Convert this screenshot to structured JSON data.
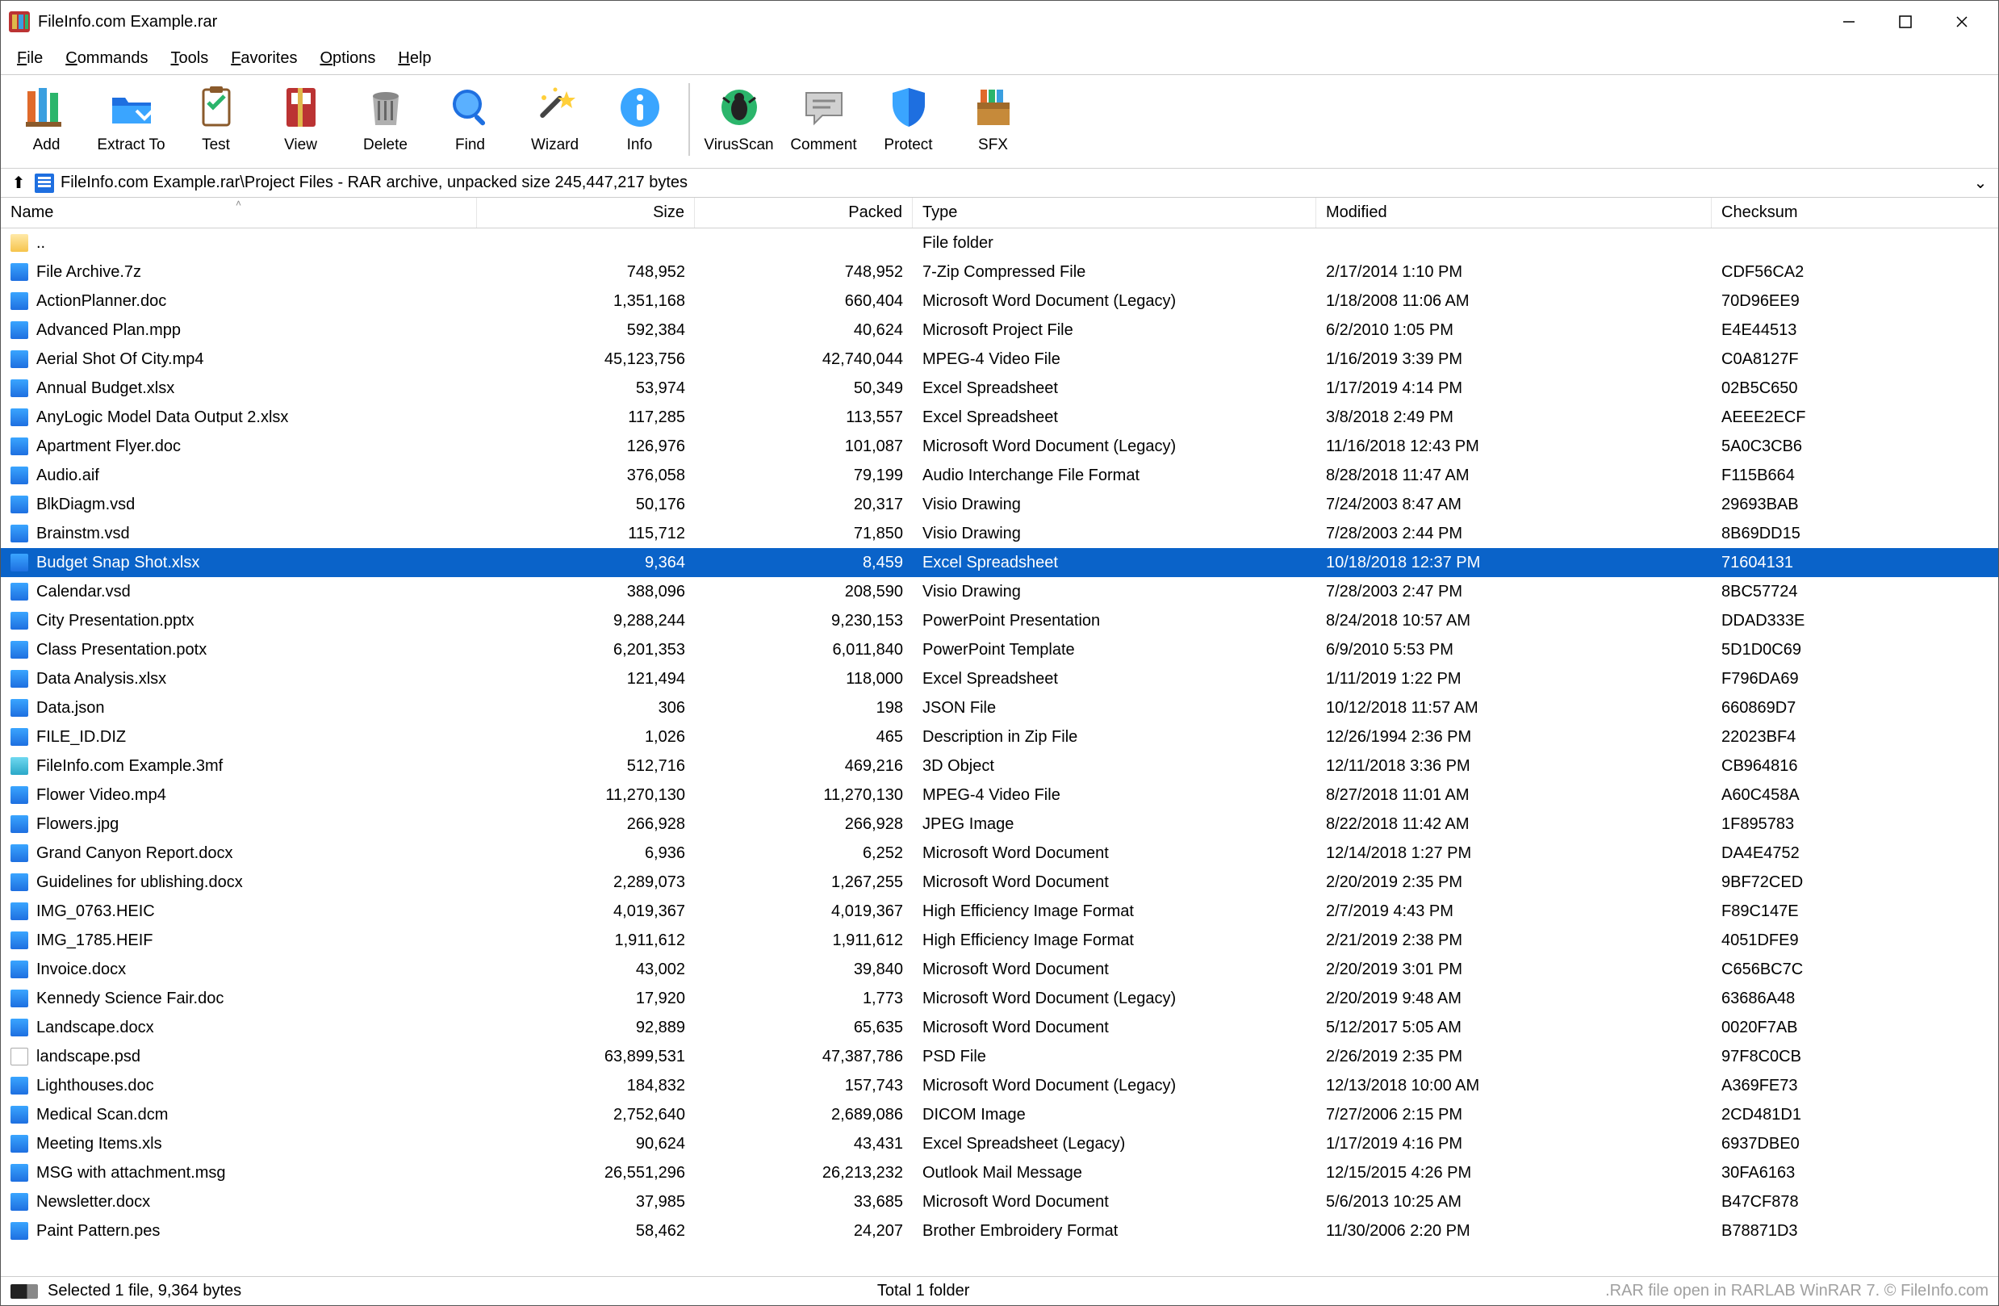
{
  "window": {
    "title": "FileInfo.com Example.rar"
  },
  "menu": {
    "items": [
      "File",
      "Commands",
      "Tools",
      "Favorites",
      "Options",
      "Help"
    ]
  },
  "toolbar": {
    "groups": [
      [
        {
          "name": "add",
          "label": "Add",
          "svg": "books"
        },
        {
          "name": "extract",
          "label": "Extract To",
          "svg": "folder"
        },
        {
          "name": "test",
          "label": "Test",
          "svg": "clipboard"
        },
        {
          "name": "view",
          "label": "View",
          "svg": "book"
        },
        {
          "name": "delete",
          "label": "Delete",
          "svg": "trash"
        },
        {
          "name": "find",
          "label": "Find",
          "svg": "lens"
        },
        {
          "name": "wizard",
          "label": "Wizard",
          "svg": "wand"
        },
        {
          "name": "info",
          "label": "Info",
          "svg": "info"
        }
      ],
      [
        {
          "name": "virusscan",
          "label": "VirusScan",
          "svg": "bug"
        },
        {
          "name": "comment",
          "label": "Comment",
          "svg": "comment"
        },
        {
          "name": "protect",
          "label": "Protect",
          "svg": "shield"
        },
        {
          "name": "sfx",
          "label": "SFX",
          "svg": "box"
        }
      ]
    ]
  },
  "address": {
    "path": "FileInfo.com Example.rar\\Project Files - RAR archive, unpacked size 245,447,217 bytes"
  },
  "columns": {
    "name": "Name",
    "size": "Size",
    "packed": "Packed",
    "type": "Type",
    "modified": "Modified",
    "checksum": "Checksum",
    "sort": "name"
  },
  "rows": [
    {
      "icon": "folder",
      "name": "..",
      "size": "",
      "packed": "",
      "type": "File folder",
      "mod": "",
      "chk": ""
    },
    {
      "icon": "blue",
      "name": "File Archive.7z",
      "size": "748,952",
      "packed": "748,952",
      "type": "7-Zip Compressed File",
      "mod": "2/17/2014 1:10 PM",
      "chk": "CDF56CA2"
    },
    {
      "icon": "blue",
      "name": "ActionPlanner.doc",
      "size": "1,351,168",
      "packed": "660,404",
      "type": "Microsoft Word Document (Legacy)",
      "mod": "1/18/2008 11:06 AM",
      "chk": "70D96EE9"
    },
    {
      "icon": "blue",
      "name": "Advanced Plan.mpp",
      "size": "592,384",
      "packed": "40,624",
      "type": "Microsoft Project File",
      "mod": "6/2/2010 1:05 PM",
      "chk": "E4E44513"
    },
    {
      "icon": "blue",
      "name": "Aerial Shot Of City.mp4",
      "size": "45,123,756",
      "packed": "42,740,044",
      "type": "MPEG-4 Video File",
      "mod": "1/16/2019 3:39 PM",
      "chk": "C0A8127F"
    },
    {
      "icon": "blue",
      "name": "Annual Budget.xlsx",
      "size": "53,974",
      "packed": "50,349",
      "type": "Excel Spreadsheet",
      "mod": "1/17/2019 4:14 PM",
      "chk": "02B5C650"
    },
    {
      "icon": "blue",
      "name": "AnyLogic Model Data Output 2.xlsx",
      "size": "117,285",
      "packed": "113,557",
      "type": "Excel Spreadsheet",
      "mod": "3/8/2018 2:49 PM",
      "chk": "AEEE2ECF"
    },
    {
      "icon": "blue",
      "name": "Apartment Flyer.doc",
      "size": "126,976",
      "packed": "101,087",
      "type": "Microsoft Word Document (Legacy)",
      "mod": "11/16/2018 12:43 PM",
      "chk": "5A0C3CB6"
    },
    {
      "icon": "blue",
      "name": "Audio.aif",
      "size": "376,058",
      "packed": "79,199",
      "type": "Audio Interchange File Format",
      "mod": "8/28/2018 11:47 AM",
      "chk": "F115B664"
    },
    {
      "icon": "blue",
      "name": "BlkDiagm.vsd",
      "size": "50,176",
      "packed": "20,317",
      "type": "Visio Drawing",
      "mod": "7/24/2003 8:47 AM",
      "chk": "29693BAB"
    },
    {
      "icon": "blue",
      "name": "Brainstm.vsd",
      "size": "115,712",
      "packed": "71,850",
      "type": "Visio Drawing",
      "mod": "7/28/2003 2:44 PM",
      "chk": "8B69DD15"
    },
    {
      "icon": "blue",
      "name": "Budget Snap Shot.xlsx",
      "size": "9,364",
      "packed": "8,459",
      "type": "Excel Spreadsheet",
      "mod": "10/18/2018 12:37 PM",
      "chk": "71604131",
      "selected": true
    },
    {
      "icon": "blue",
      "name": "Calendar.vsd",
      "size": "388,096",
      "packed": "208,590",
      "type": "Visio Drawing",
      "mod": "7/28/2003 2:47 PM",
      "chk": "8BC57724"
    },
    {
      "icon": "blue",
      "name": "City Presentation.pptx",
      "size": "9,288,244",
      "packed": "9,230,153",
      "type": "PowerPoint Presentation",
      "mod": "8/24/2018 10:57 AM",
      "chk": "DDAD333E"
    },
    {
      "icon": "blue",
      "name": "Class Presentation.potx",
      "size": "6,201,353",
      "packed": "6,011,840",
      "type": "PowerPoint Template",
      "mod": "6/9/2010 5:53 PM",
      "chk": "5D1D0C69"
    },
    {
      "icon": "blue",
      "name": "Data Analysis.xlsx",
      "size": "121,494",
      "packed": "118,000",
      "type": "Excel Spreadsheet",
      "mod": "1/11/2019 1:22 PM",
      "chk": "F796DA69"
    },
    {
      "icon": "blue",
      "name": "Data.json",
      "size": "306",
      "packed": "198",
      "type": "JSON File",
      "mod": "10/12/2018 11:57 AM",
      "chk": "660869D7"
    },
    {
      "icon": "blue",
      "name": "FILE_ID.DIZ",
      "size": "1,026",
      "packed": "465",
      "type": "Description in Zip File",
      "mod": "12/26/1994 2:36 PM",
      "chk": "22023BF4"
    },
    {
      "icon": "cyan",
      "name": "FileInfo.com Example.3mf",
      "size": "512,716",
      "packed": "469,216",
      "type": "3D Object",
      "mod": "12/11/2018 3:36 PM",
      "chk": "CB964816"
    },
    {
      "icon": "blue",
      "name": "Flower Video.mp4",
      "size": "11,270,130",
      "packed": "11,270,130",
      "type": "MPEG-4 Video File",
      "mod": "8/27/2018 11:01 AM",
      "chk": "A60C458A"
    },
    {
      "icon": "blue",
      "name": "Flowers.jpg",
      "size": "266,928",
      "packed": "266,928",
      "type": "JPEG Image",
      "mod": "8/22/2018 11:42 AM",
      "chk": "1F895783"
    },
    {
      "icon": "blue",
      "name": "Grand Canyon Report.docx",
      "size": "6,936",
      "packed": "6,252",
      "type": "Microsoft Word Document",
      "mod": "12/14/2018 1:27 PM",
      "chk": "DA4E4752"
    },
    {
      "icon": "blue",
      "name": "Guidelines for ublishing.docx",
      "size": "2,289,073",
      "packed": "1,267,255",
      "type": "Microsoft Word Document",
      "mod": "2/20/2019 2:35 PM",
      "chk": "9BF72CED"
    },
    {
      "icon": "blue",
      "name": "IMG_0763.HEIC",
      "size": "4,019,367",
      "packed": "4,019,367",
      "type": "High Efficiency Image Format",
      "mod": "2/7/2019 4:43 PM",
      "chk": "F89C147E"
    },
    {
      "icon": "blue",
      "name": "IMG_1785.HEIF",
      "size": "1,911,612",
      "packed": "1,911,612",
      "type": "High Efficiency Image Format",
      "mod": "2/21/2019 2:38 PM",
      "chk": "4051DFE9"
    },
    {
      "icon": "blue",
      "name": "Invoice.docx",
      "size": "43,002",
      "packed": "39,840",
      "type": "Microsoft Word Document",
      "mod": "2/20/2019 3:01 PM",
      "chk": "C656BC7C"
    },
    {
      "icon": "blue",
      "name": "Kennedy Science Fair.doc",
      "size": "17,920",
      "packed": "1,773",
      "type": "Microsoft Word Document (Legacy)",
      "mod": "2/20/2019 9:48 AM",
      "chk": "63686A48"
    },
    {
      "icon": "blue",
      "name": "Landscape.docx",
      "size": "92,889",
      "packed": "65,635",
      "type": "Microsoft Word Document",
      "mod": "5/12/2017 5:05 AM",
      "chk": "0020F7AB"
    },
    {
      "icon": "doc",
      "name": "landscape.psd",
      "size": "63,899,531",
      "packed": "47,387,786",
      "type": "PSD File",
      "mod": "2/26/2019 2:35 PM",
      "chk": "97F8C0CB"
    },
    {
      "icon": "blue",
      "name": "Lighthouses.doc",
      "size": "184,832",
      "packed": "157,743",
      "type": "Microsoft Word Document (Legacy)",
      "mod": "12/13/2018 10:00 AM",
      "chk": "A369FE73"
    },
    {
      "icon": "blue",
      "name": "Medical Scan.dcm",
      "size": "2,752,640",
      "packed": "2,689,086",
      "type": "DICOM Image",
      "mod": "7/27/2006 2:15 PM",
      "chk": "2CD481D1"
    },
    {
      "icon": "blue",
      "name": "Meeting Items.xls",
      "size": "90,624",
      "packed": "43,431",
      "type": "Excel Spreadsheet (Legacy)",
      "mod": "1/17/2019 4:16 PM",
      "chk": "6937DBE0"
    },
    {
      "icon": "blue",
      "name": "MSG with attachment.msg",
      "size": "26,551,296",
      "packed": "26,213,232",
      "type": "Outlook Mail Message",
      "mod": "12/15/2015 4:26 PM",
      "chk": "30FA6163"
    },
    {
      "icon": "blue",
      "name": "Newsletter.docx",
      "size": "37,985",
      "packed": "33,685",
      "type": "Microsoft Word Document",
      "mod": "5/6/2013 10:25 AM",
      "chk": "B47CF878"
    },
    {
      "icon": "blue",
      "name": "Paint Pattern.pes",
      "size": "58,462",
      "packed": "24,207",
      "type": "Brother Embroidery Format",
      "mod": "11/30/2006 2:20 PM",
      "chk": "B78871D3"
    }
  ],
  "status": {
    "left": "Selected 1 file, 9,364 bytes",
    "center": "Total 1 folder",
    "right": ".RAR file open in RARLAB WinRAR 7. © FileInfo.com"
  }
}
